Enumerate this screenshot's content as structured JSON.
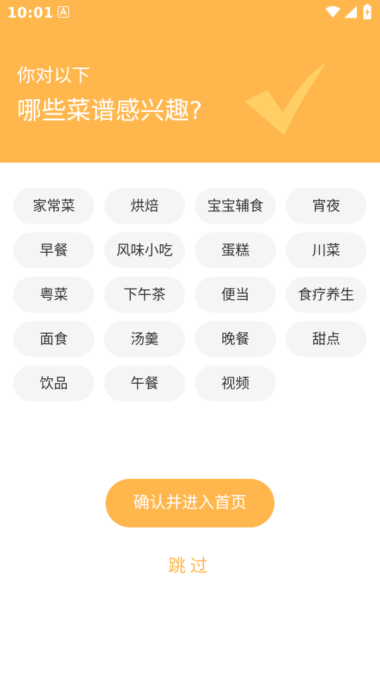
{
  "status_bar": {
    "time": "10:01"
  },
  "header": {
    "subtitle": "你对以下",
    "title": "哪些菜谱感兴趣?"
  },
  "tags": [
    {
      "label": "家常菜"
    },
    {
      "label": "烘焙"
    },
    {
      "label": "宝宝辅食"
    },
    {
      "label": "宵夜"
    },
    {
      "label": "早餐"
    },
    {
      "label": "风味小吃"
    },
    {
      "label": "蛋糕"
    },
    {
      "label": "川菜"
    },
    {
      "label": "粤菜"
    },
    {
      "label": "下午茶"
    },
    {
      "label": "便当"
    },
    {
      "label": "食疗养生"
    },
    {
      "label": "面食"
    },
    {
      "label": "汤羹"
    },
    {
      "label": "晚餐"
    },
    {
      "label": "甜点"
    },
    {
      "label": "饮品"
    },
    {
      "label": "午餐"
    },
    {
      "label": "视频"
    }
  ],
  "actions": {
    "confirm_label": "确认并进入首页",
    "skip_label": "跳过"
  },
  "colors": {
    "accent": "#FFB74D",
    "tag_background": "#F5F5F5",
    "tag_text": "#333333"
  }
}
